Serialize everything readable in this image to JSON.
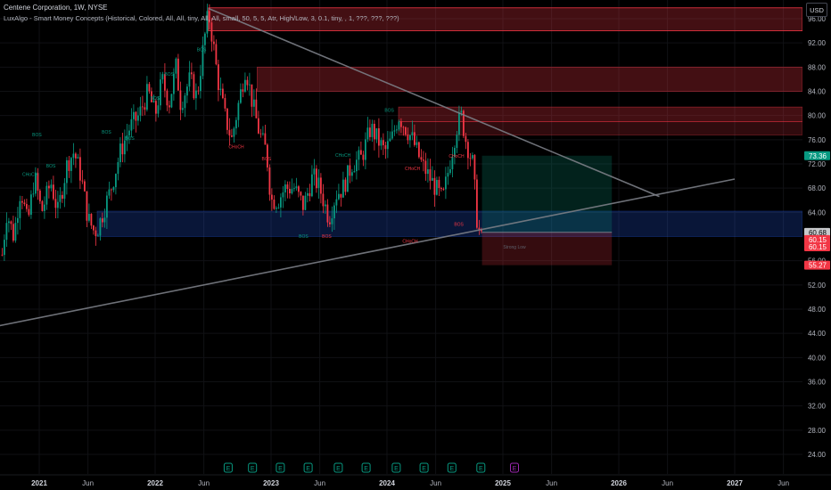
{
  "header": {
    "symbol_line": "Centene Corporation, 1W, NYSE",
    "indicator_line": "LuxAlgo - Smart Money Concepts (Historical, Colored, All, All, tiny, All, All, small, 50, 5, 5, Atr, High/Low, 3, 0.1, tiny, , 1, ???, ???, ???)"
  },
  "currency_button": "USD",
  "chart_data": {
    "type": "candlestick",
    "title": "Centene Corporation, 1W, NYSE",
    "y_ticks": [
      24.0,
      28.0,
      32.0,
      36.0,
      40.0,
      44.0,
      48.0,
      52.0,
      56.0,
      64.0,
      68.0,
      72.0,
      76.0,
      80.0,
      84.0,
      88.0,
      92.0,
      96.0
    ],
    "x_labels": [
      {
        "label": "2021",
        "t": 2021.0,
        "bold": true
      },
      {
        "label": "Jun",
        "t": 2021.42,
        "bold": false
      },
      {
        "label": "2022",
        "t": 2022.0,
        "bold": true
      },
      {
        "label": "Jun",
        "t": 2022.42,
        "bold": false
      },
      {
        "label": "2023",
        "t": 2023.0,
        "bold": true
      },
      {
        "label": "Jun",
        "t": 2023.42,
        "bold": false
      },
      {
        "label": "2024",
        "t": 2024.0,
        "bold": true
      },
      {
        "label": "Jun",
        "t": 2024.42,
        "bold": false
      },
      {
        "label": "2025",
        "t": 2025.0,
        "bold": true
      },
      {
        "label": "Jun",
        "t": 2025.42,
        "bold": false
      },
      {
        "label": "2026",
        "t": 2026.0,
        "bold": true
      },
      {
        "label": "Jun",
        "t": 2026.42,
        "bold": false
      },
      {
        "label": "2027",
        "t": 2027.0,
        "bold": true
      },
      {
        "label": "Jun",
        "t": 2027.42,
        "bold": false
      }
    ],
    "price_labels": [
      {
        "value": "73.36",
        "y": 73.36,
        "color": "#089981"
      },
      {
        "value": "60.68",
        "y": 60.68,
        "color": "#c8c9cc"
      },
      {
        "value": "60.15",
        "y": 59.5,
        "color": "#f23645"
      },
      {
        "value": "60.15",
        "y": 58.3,
        "color": "#f23645"
      },
      {
        "value": "55.27",
        "y": 55.27,
        "color": "#f23645"
      }
    ],
    "price_path": [
      [
        2020.68,
        57
      ],
      [
        2020.72,
        64
      ],
      [
        2020.78,
        60
      ],
      [
        2020.84,
        68
      ],
      [
        2020.9,
        62
      ],
      [
        2020.96,
        70
      ],
      [
        2021.02,
        64
      ],
      [
        2021.1,
        69
      ],
      [
        2021.16,
        64
      ],
      [
        2021.24,
        72
      ],
      [
        2021.3,
        74
      ],
      [
        2021.36,
        70
      ],
      [
        2021.42,
        63
      ],
      [
        2021.47,
        61
      ],
      [
        2021.5,
        61
      ],
      [
        2021.55,
        64
      ],
      [
        2021.62,
        68
      ],
      [
        2021.7,
        74
      ],
      [
        2021.78,
        78
      ],
      [
        2021.86,
        80
      ],
      [
        2021.94,
        84
      ],
      [
        2022.0,
        80
      ],
      [
        2022.06,
        86
      ],
      [
        2022.12,
        82
      ],
      [
        2022.18,
        88
      ],
      [
        2022.22,
        82
      ],
      [
        2022.3,
        86
      ],
      [
        2022.36,
        83
      ],
      [
        2022.42,
        92
      ],
      [
        2022.46,
        97
      ],
      [
        2022.5,
        92
      ],
      [
        2022.54,
        86
      ],
      [
        2022.6,
        80
      ],
      [
        2022.66,
        76
      ],
      [
        2022.72,
        82
      ],
      [
        2022.78,
        88
      ],
      [
        2022.84,
        82
      ],
      [
        2022.9,
        77
      ],
      [
        2022.96,
        74
      ],
      [
        2023.0,
        66
      ],
      [
        2023.06,
        66
      ],
      [
        2023.12,
        68
      ],
      [
        2023.2,
        68
      ],
      [
        2023.28,
        65
      ],
      [
        2023.36,
        70
      ],
      [
        2023.42,
        68
      ],
      [
        2023.5,
        63
      ],
      [
        2023.56,
        67
      ],
      [
        2023.62,
        68
      ],
      [
        2023.7,
        72
      ],
      [
        2023.78,
        73
      ],
      [
        2023.86,
        78
      ],
      [
        2023.92,
        76
      ],
      [
        2023.98,
        74
      ],
      [
        2024.04,
        76
      ],
      [
        2024.1,
        80
      ],
      [
        2024.16,
        78
      ],
      [
        2024.22,
        76
      ],
      [
        2024.3,
        72
      ],
      [
        2024.36,
        70
      ],
      [
        2024.42,
        68
      ],
      [
        2024.48,
        66
      ],
      [
        2024.54,
        72
      ],
      [
        2024.6,
        78
      ],
      [
        2024.64,
        80
      ],
      [
        2024.68,
        76
      ],
      [
        2024.74,
        72
      ],
      [
        2024.78,
        62
      ],
      [
        2024.82,
        59
      ]
    ],
    "trend_lines": [
      {
        "name": "descending-trendline",
        "x1": 2022.46,
        "y1": 97.7,
        "x2": 2026.35,
        "y2": 66.6,
        "color": "#7b7e86"
      },
      {
        "name": "ascending-trendline",
        "x1": 2019.8,
        "y1": 42.0,
        "x2": 2027.0,
        "y2": 69.5,
        "color": "#7b7e86"
      }
    ],
    "zones": [
      {
        "name": "supply-zone-top",
        "x1": 2022.46,
        "x2": 2028.0,
        "y1": 94.0,
        "y2": 97.8,
        "fill": "rgba(242,54,69,0.28)",
        "stroke": "#f23645"
      },
      {
        "name": "supply-zone-2",
        "x1": 2022.88,
        "x2": 2028.0,
        "y1": 84.0,
        "y2": 88.0,
        "fill": "rgba(242,54,69,0.28)",
        "stroke": "rgba(242,54,69,0.5)"
      },
      {
        "name": "supply-zone-3",
        "x1": 2024.1,
        "x2": 2028.0,
        "y1": 79.0,
        "y2": 81.4,
        "fill": "rgba(242,54,69,0.28)",
        "stroke": "rgba(242,54,69,0.5)"
      },
      {
        "name": "supply-zone-4",
        "x1": 2024.1,
        "x2": 2028.0,
        "y1": 76.8,
        "y2": 79.0,
        "fill": "rgba(242,54,69,0.2)",
        "stroke": "rgba(242,54,69,0.4)"
      },
      {
        "name": "demand-zone",
        "x1": 2021.5,
        "x2": 2028.0,
        "y1": 60.0,
        "y2": 64.2,
        "fill": "rgba(41,98,255,0.22)",
        "stroke": "rgba(41,98,255,0.3)"
      },
      {
        "name": "long-profit-zone",
        "x1": 2024.82,
        "x2": 2025.94,
        "y1": 60.7,
        "y2": 73.36,
        "fill": "rgba(8,153,129,0.22)",
        "stroke": "none"
      },
      {
        "name": "long-stop-zone",
        "x1": 2024.82,
        "x2": 2025.94,
        "y1": 55.27,
        "y2": 60.7,
        "fill": "rgba(242,54,69,0.22)",
        "stroke": "none"
      }
    ],
    "structure_labels": [
      {
        "text": "BOS",
        "t": 2020.98,
        "y": 76.6,
        "color": "#089981"
      },
      {
        "text": "BOS",
        "t": 2021.1,
        "y": 71.4,
        "color": "#089981"
      },
      {
        "text": "CHoCH",
        "t": 2020.92,
        "y": 70.0,
        "color": "#089981"
      },
      {
        "text": "BOS",
        "t": 2021.58,
        "y": 77.0,
        "color": "#089981"
      },
      {
        "text": "BOS",
        "t": 2021.78,
        "y": 76.0,
        "color": "#089981"
      },
      {
        "text": "BOS",
        "t": 2022.12,
        "y": 86.6,
        "color": "#089981"
      },
      {
        "text": "BOS",
        "t": 2022.0,
        "y": 82.6,
        "color": "#089981"
      },
      {
        "text": "BOS",
        "t": 2022.4,
        "y": 90.6,
        "color": "#089981"
      },
      {
        "text": "CHoCH",
        "t": 2022.7,
        "y": 74.6,
        "color": "#f23645"
      },
      {
        "text": "BOS",
        "t": 2022.96,
        "y": 72.6,
        "color": "#f23645"
      },
      {
        "text": "CHoCH",
        "t": 2023.62,
        "y": 73.2,
        "color": "#089981"
      },
      {
        "text": "BOS",
        "t": 2024.02,
        "y": 80.6,
        "color": "#089981"
      },
      {
        "text": "BOS",
        "t": 2023.28,
        "y": 59.8,
        "color": "#089981"
      },
      {
        "text": "BOS",
        "t": 2023.48,
        "y": 59.8,
        "color": "#f23645"
      },
      {
        "text": "CHoCH",
        "t": 2024.22,
        "y": 71.0,
        "color": "#f23645"
      },
      {
        "text": "BOS",
        "t": 2024.62,
        "y": 61.8,
        "color": "#f23645"
      },
      {
        "text": "CHoCH",
        "t": 2024.2,
        "y": 59.0,
        "color": "#f23645"
      },
      {
        "text": "CHoCH",
        "t": 2024.6,
        "y": 73.0,
        "color": "#f23645"
      },
      {
        "text": "Strong Low",
        "t": 2025.1,
        "y": 58.0,
        "color": "#5d606b"
      }
    ],
    "event_markers": [
      {
        "label": "E",
        "t": 2022.63,
        "color": "#089981"
      },
      {
        "label": "E",
        "t": 2022.84,
        "color": "#089981"
      },
      {
        "label": "E",
        "t": 2023.08,
        "color": "#089981"
      },
      {
        "label": "E",
        "t": 2023.32,
        "color": "#089981"
      },
      {
        "label": "E",
        "t": 2023.58,
        "color": "#089981"
      },
      {
        "label": "E",
        "t": 2023.82,
        "color": "#089981"
      },
      {
        "label": "E",
        "t": 2024.08,
        "color": "#089981"
      },
      {
        "label": "E",
        "t": 2024.32,
        "color": "#089981"
      },
      {
        "label": "E",
        "t": 2024.56,
        "color": "#089981"
      },
      {
        "label": "E",
        "t": 2024.81,
        "color": "#089981"
      },
      {
        "label": "E",
        "t": 2025.1,
        "color": "#9c27b0"
      }
    ],
    "colors": {
      "up": "#089981",
      "down": "#f23645",
      "grid": "#101114",
      "axis_text": "#b2b5be"
    }
  }
}
